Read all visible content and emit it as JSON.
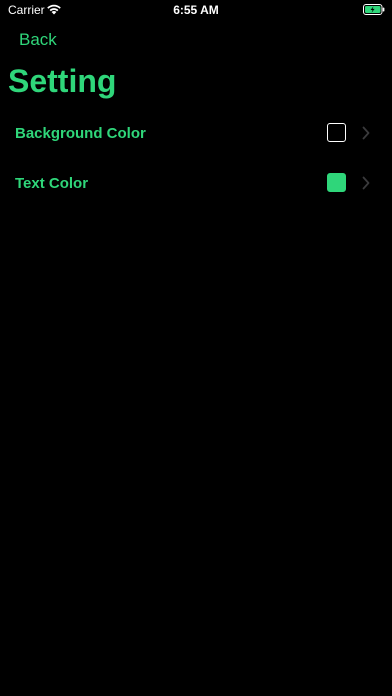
{
  "status_bar": {
    "carrier": "Carrier",
    "time": "6:55 AM",
    "wifi_icon": "wifi-icon",
    "battery_icon": "battery-charging-icon"
  },
  "nav": {
    "back_label": "Back",
    "title": "Setting"
  },
  "settings": {
    "items": [
      {
        "label": "Background Color",
        "swatch_color": "#000000",
        "icon": "chevron-right-icon"
      },
      {
        "label": "Text Color",
        "swatch_color": "#2fd67a",
        "icon": "chevron-right-icon"
      }
    ]
  },
  "theme": {
    "accent": "#2fd67a",
    "background": "#000000"
  }
}
